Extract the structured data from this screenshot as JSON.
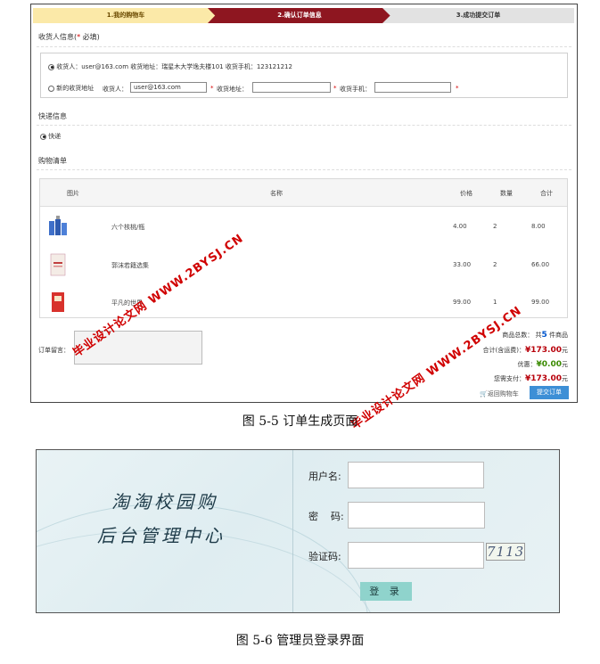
{
  "order_page": {
    "steps": [
      "1.我的购物车",
      "2.确认订单信息",
      "3.成功提交订单"
    ],
    "consignee_title": "收货人信息(",
    "consignee_required": "*",
    "consignee_required_text": " 必填)",
    "address_option_1": "收货人：user@163.com  收货地址：瑞星木大学逸夫楼101  收货手机：123121212",
    "address_option_2_label": "新的收货地址",
    "receiver_label": "收货人：",
    "receiver_value": "user@163.com",
    "address_label": "收货地址：",
    "phone_label": "收货手机：",
    "required_mark": "*",
    "express_title": "快递信息",
    "express_option": "快递",
    "cart_title": "购物清单",
    "table_headers": [
      "图片",
      "名称",
      "价格",
      "数量",
      "合计"
    ],
    "rows": [
      {
        "name": "六个核桃/瓶",
        "price": "4.00",
        "qty": "2",
        "total": "8.00"
      },
      {
        "name": "郭沫若籍选集",
        "price": "33.00",
        "qty": "2",
        "total": "66.00"
      },
      {
        "name": "平凡的世界",
        "price": "99.00",
        "qty": "1",
        "total": "99.00"
      }
    ],
    "message_label": "订单留言：",
    "summary": {
      "count_label": "商品总数：",
      "count_prefix": "共",
      "count_value": "5",
      "count_suffix": " 件商品",
      "total_label": "合计(含运费)：",
      "total_value": "¥173.00",
      "unit": "元",
      "discount_label": "优惠：",
      "discount_value": "¥0.00",
      "pay_label": "您需支付：",
      "pay_value": "¥173.00"
    },
    "back_link": "返回购物车",
    "submit_button": "提交订单"
  },
  "watermark_text": "毕业设计论文网 WWW.2BYSJ.CN",
  "caption_1": "图 5-5    订单生成页面",
  "login_page": {
    "brand_line_1": "淘淘校园购",
    "brand_line_2": "后台管理中心",
    "username_label": "用户名:",
    "password_label": "密    码:",
    "captcha_label": "验证码:",
    "captcha_text": "7113",
    "login_button": "登 录"
  },
  "caption_2": "图 5-6    管理员登录界面"
}
